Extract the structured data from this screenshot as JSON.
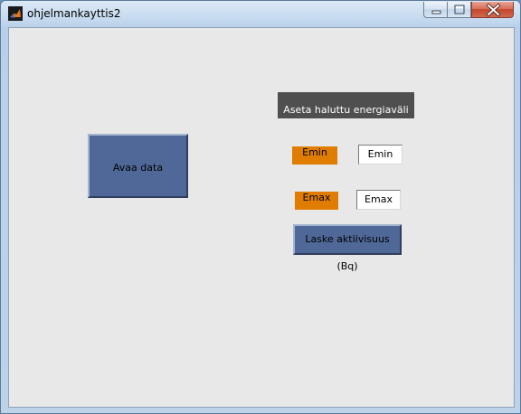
{
  "window": {
    "title": "ohjelmankayttis2",
    "app_icon": "matlab-icon",
    "controls": {
      "minimize_icon": "minimize-icon",
      "maximize_icon": "maximize-icon",
      "close_icon": "close-icon"
    }
  },
  "panel": {
    "header_label": "Aseta haluttu energiaväli",
    "open_button_label": "Avaa data",
    "emin_label": "Emin",
    "emin_value": "Emin",
    "emax_label": "Emax",
    "emax_value": "Emax",
    "calc_button_label": "Laske aktiivisuus (Bq)"
  },
  "colors": {
    "background": "#e8e8e8",
    "button": "#4f6898",
    "tag": "#e07d00",
    "header": "#4f4f4f"
  }
}
